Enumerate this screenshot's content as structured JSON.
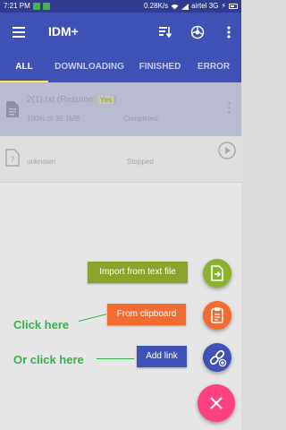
{
  "status_bar": {
    "time": "7:21 PM",
    "speed": "0.28K/s",
    "carrier": "airtel 3G"
  },
  "app_bar": {
    "title": "IDM+",
    "icons": [
      "menu-icon",
      "sort-icon",
      "browser-icon",
      "more-vert-icon"
    ]
  },
  "tabs": [
    {
      "label": "ALL",
      "active": true
    },
    {
      "label": "DOWNLOADING",
      "active": false
    },
    {
      "label": "FINISHED",
      "active": false
    },
    {
      "label": "ERROR",
      "active": false
    }
  ],
  "downloads": [
    {
      "title": "2(1).txt (Resume:",
      "resume_value": "Yes",
      "title_end": ")",
      "progress": "100% of 39.1MB",
      "status": "Completed"
    },
    {
      "title": "",
      "progress": "unknown",
      "status": "Stopped"
    }
  ],
  "fab_menu": {
    "import_label": "Import from text file",
    "clipboard_label": "From clipboard",
    "link_label": "Add link"
  },
  "annotations": {
    "click_here": "Click here",
    "or_click_here": "Or click here"
  },
  "colors": {
    "primary": "#3f51b5",
    "status_bar": "#2f3c8f",
    "accent": "#ff4081",
    "import_green": "#8aa52c",
    "clipboard_orange": "#f26c2f",
    "annotation_green": "#3ab14a"
  }
}
